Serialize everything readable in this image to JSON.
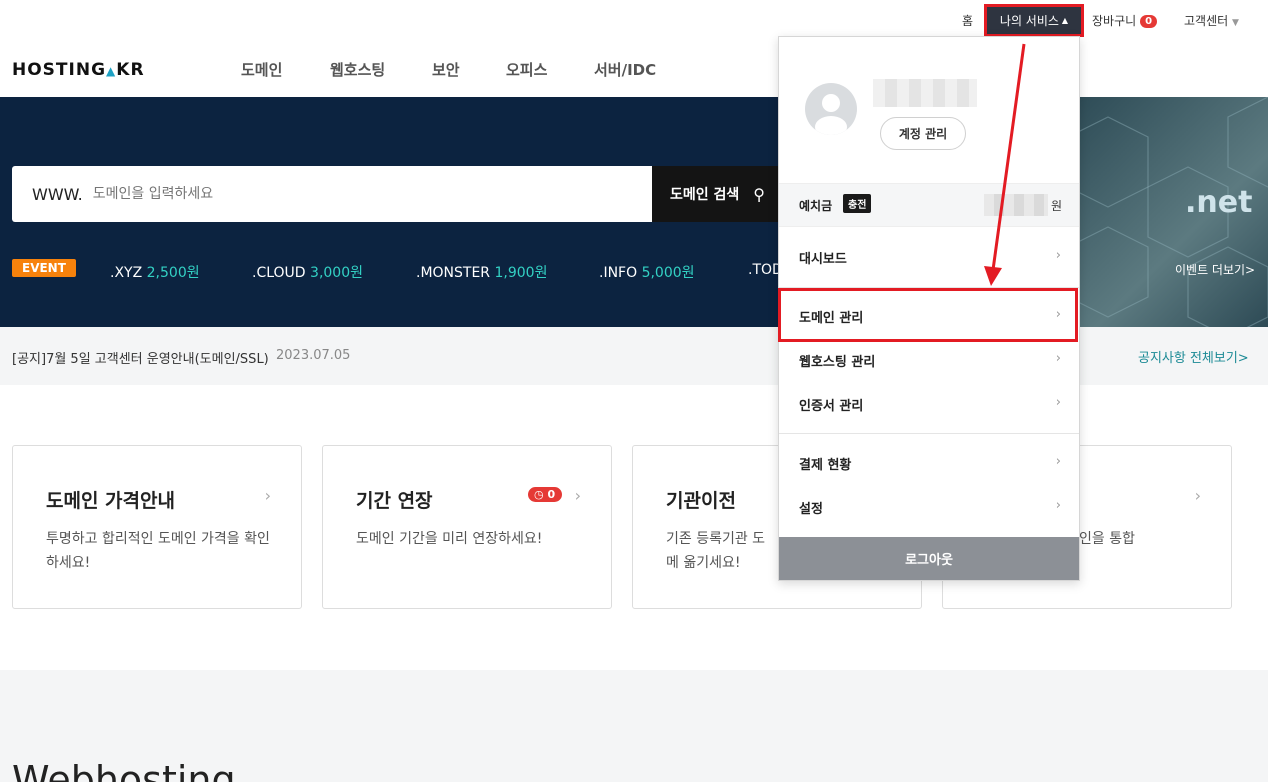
{
  "util": {
    "home": "홈",
    "my_service": "나의 서비스",
    "cart": "장바구니",
    "cart_count": "0",
    "support": "고객센터"
  },
  "header": {
    "logo_left": "HOSTING",
    "logo_right": "KR",
    "nav": [
      "도메인",
      "웹호스팅",
      "보안",
      "오피스",
      "서버/IDC"
    ]
  },
  "hero": {
    "search_prefix": "WWW.",
    "search_placeholder": "도메인을 입력하세요",
    "search_button": "도메인 검색",
    "event_badge": "EVENT",
    "promos": [
      {
        "tld": ".XYZ",
        "price": "2,500원"
      },
      {
        "tld": ".CLOUD",
        "price": "3,000원"
      },
      {
        "tld": ".MONSTER",
        "price": "1,900원"
      },
      {
        "tld": ".INFO",
        "price": "5,000원"
      },
      {
        "tld": ".TOD",
        "price": ""
      }
    ],
    "banner_text": ".net",
    "event_more": "이벤트 더보기>"
  },
  "notice": {
    "text": "[공지]7월 5일 고객센터 운영안내(도메인/SSL)",
    "date": "2023.07.05",
    "all": "공지사항 전체보기>"
  },
  "cards": [
    {
      "title": "도메인 가격안내",
      "desc": "투명하고 합리적인 도메인 가격을 확인하세요!"
    },
    {
      "title": "기간 연장",
      "desc": "도메인 기간을 미리 연장하세요!",
      "badge": "0"
    },
    {
      "title": "기관이전",
      "desc": "기존 등록기관 도메 옮기세요!"
    },
    {
      "title": "",
      "desc": "인을 통합"
    }
  ],
  "section": {
    "title": "Webhosting"
  },
  "dropdown": {
    "account_button": "계정 관리",
    "deposit_label": "예치금",
    "charge_button": "충전",
    "deposit_unit": "원",
    "items": [
      "대시보드",
      "도메인 관리",
      "웹호스팅 관리",
      "인증서 관리",
      "결제 현황",
      "설정"
    ],
    "logout": "로그아웃"
  },
  "colors": {
    "hero_bg": "#0c2340",
    "accent_price": "#33d1c4",
    "event": "#f7820c",
    "highlight": "#e31b23"
  }
}
